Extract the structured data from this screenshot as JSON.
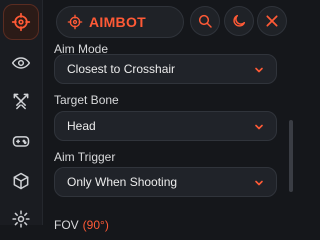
{
  "app": {
    "title": "AIMBOT",
    "accent_color": "#ff5a36"
  },
  "sidebar": {
    "items": [
      {
        "icon": "crosshair-icon",
        "active": true
      },
      {
        "icon": "eye-icon",
        "active": false
      },
      {
        "icon": "crossed-swords-icon",
        "active": false
      },
      {
        "icon": "gamepad-icon",
        "active": false
      },
      {
        "icon": "package-icon",
        "active": false
      },
      {
        "icon": "gear-icon",
        "active": false
      }
    ]
  },
  "header": {
    "icons": [
      "search-icon",
      "moon-icon",
      "close-icon"
    ]
  },
  "settings": {
    "aim_mode": {
      "label": "Aim Mode",
      "value": "Closest to Crosshair"
    },
    "target_bone": {
      "label": "Target Bone",
      "value": "Head"
    },
    "aim_trigger": {
      "label": "Aim Trigger",
      "value": "Only When Shooting"
    },
    "fov": {
      "label": "FOV",
      "value": "(90°)"
    }
  }
}
